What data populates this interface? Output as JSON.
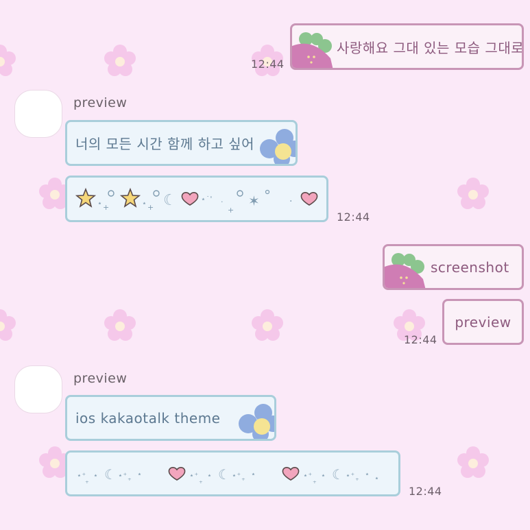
{
  "theme": {
    "background": "#fbe9f8",
    "outgoing_border": "#c895b6",
    "outgoing_fill": "#fbf1f8",
    "outgoing_text": "#8d5a7e",
    "incoming_border": "#a9cedb",
    "incoming_fill": "#edf5fb",
    "incoming_text": "#5c7890",
    "background_flower_color": "#f5c8ea"
  },
  "chat": {
    "message_1": {
      "text": "사랑해요 그대 있는 모습 그대로",
      "time": "12:44",
      "direction": "outgoing",
      "decoration": "pink-flower-icon"
    },
    "group_1": {
      "sender": "preview",
      "message_1": {
        "text": "너의 모든 시간 함께 하고 싶어",
        "decoration": "blue-flower-icon"
      },
      "message_2": {
        "symbols": "star, moon, heart, sparkle, asterisk, heart",
        "time": "12:44"
      }
    },
    "message_2": {
      "text": "screenshot",
      "direction": "outgoing",
      "decoration": "pink-flower-icon"
    },
    "message_3": {
      "text": "preview",
      "time": "12:44",
      "direction": "outgoing"
    },
    "group_2": {
      "sender": "preview",
      "message_1": {
        "text": "ios kakaotalk theme",
        "decoration": "blue-flower-icon"
      },
      "message_2": {
        "symbols": "sparkles, moon, heart (repeated)",
        "time": "12:44"
      }
    }
  }
}
